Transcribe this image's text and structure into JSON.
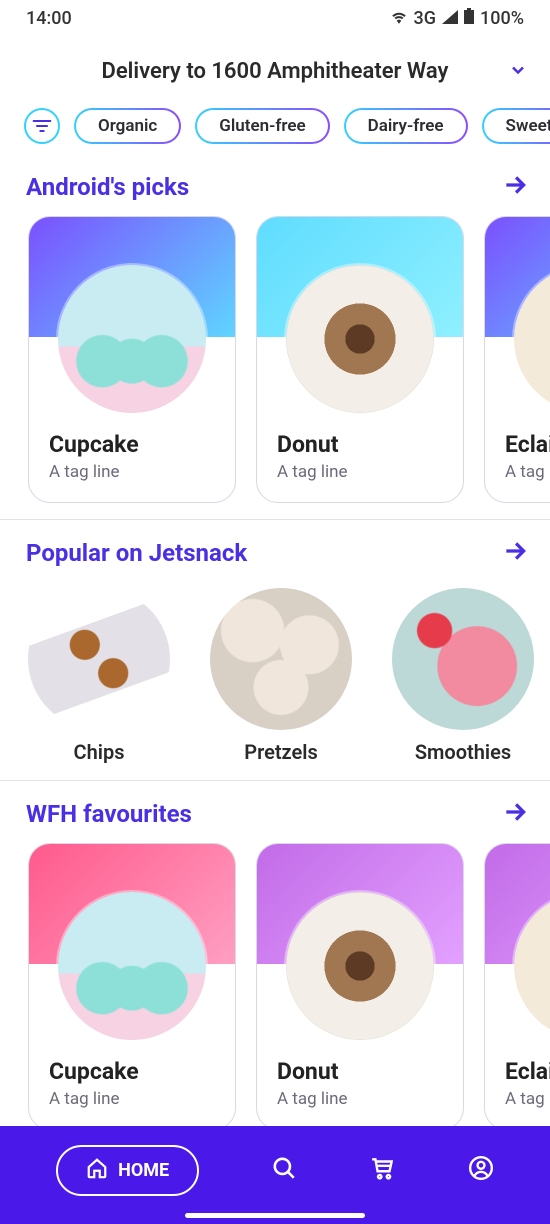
{
  "status": {
    "time": "14:00",
    "net": "3G",
    "battery": "100%"
  },
  "header": {
    "title": "Delivery to 1600 Amphitheater Way"
  },
  "filters": {
    "chips": [
      "Organic",
      "Gluten-free",
      "Dairy-free",
      "Sweet"
    ]
  },
  "sections": {
    "picks": {
      "title": "Android's picks",
      "cards": [
        {
          "name": "Cupcake",
          "tagline": "A tag line",
          "img": "cupcake",
          "grad": "default"
        },
        {
          "name": "Donut",
          "tagline": "A tag line",
          "img": "donut",
          "grad": "cyan"
        },
        {
          "name": "Eclair",
          "tagline": "A tag line",
          "img": "eclair",
          "grad": "default"
        }
      ]
    },
    "popular": {
      "title": "Popular on Jetsnack",
      "items": [
        {
          "label": "Chips",
          "img": "chips"
        },
        {
          "label": "Pretzels",
          "img": "pretzel"
        },
        {
          "label": "Smoothies",
          "img": "smoothie"
        }
      ]
    },
    "wfh": {
      "title": "WFH favourites",
      "cards": [
        {
          "name": "Cupcake",
          "tagline": "A tag line",
          "img": "cupcake",
          "grad": "pink"
        },
        {
          "name": "Donut",
          "tagline": "A tag line",
          "img": "donut",
          "grad": "purple"
        },
        {
          "name": "Eclair",
          "tagline": "A tag line",
          "img": "eclair",
          "grad": "purple"
        }
      ]
    }
  },
  "nav": {
    "home": "HOME"
  },
  "colors": {
    "accent": "#4b2fe4",
    "navBg": "#4a18e9"
  }
}
